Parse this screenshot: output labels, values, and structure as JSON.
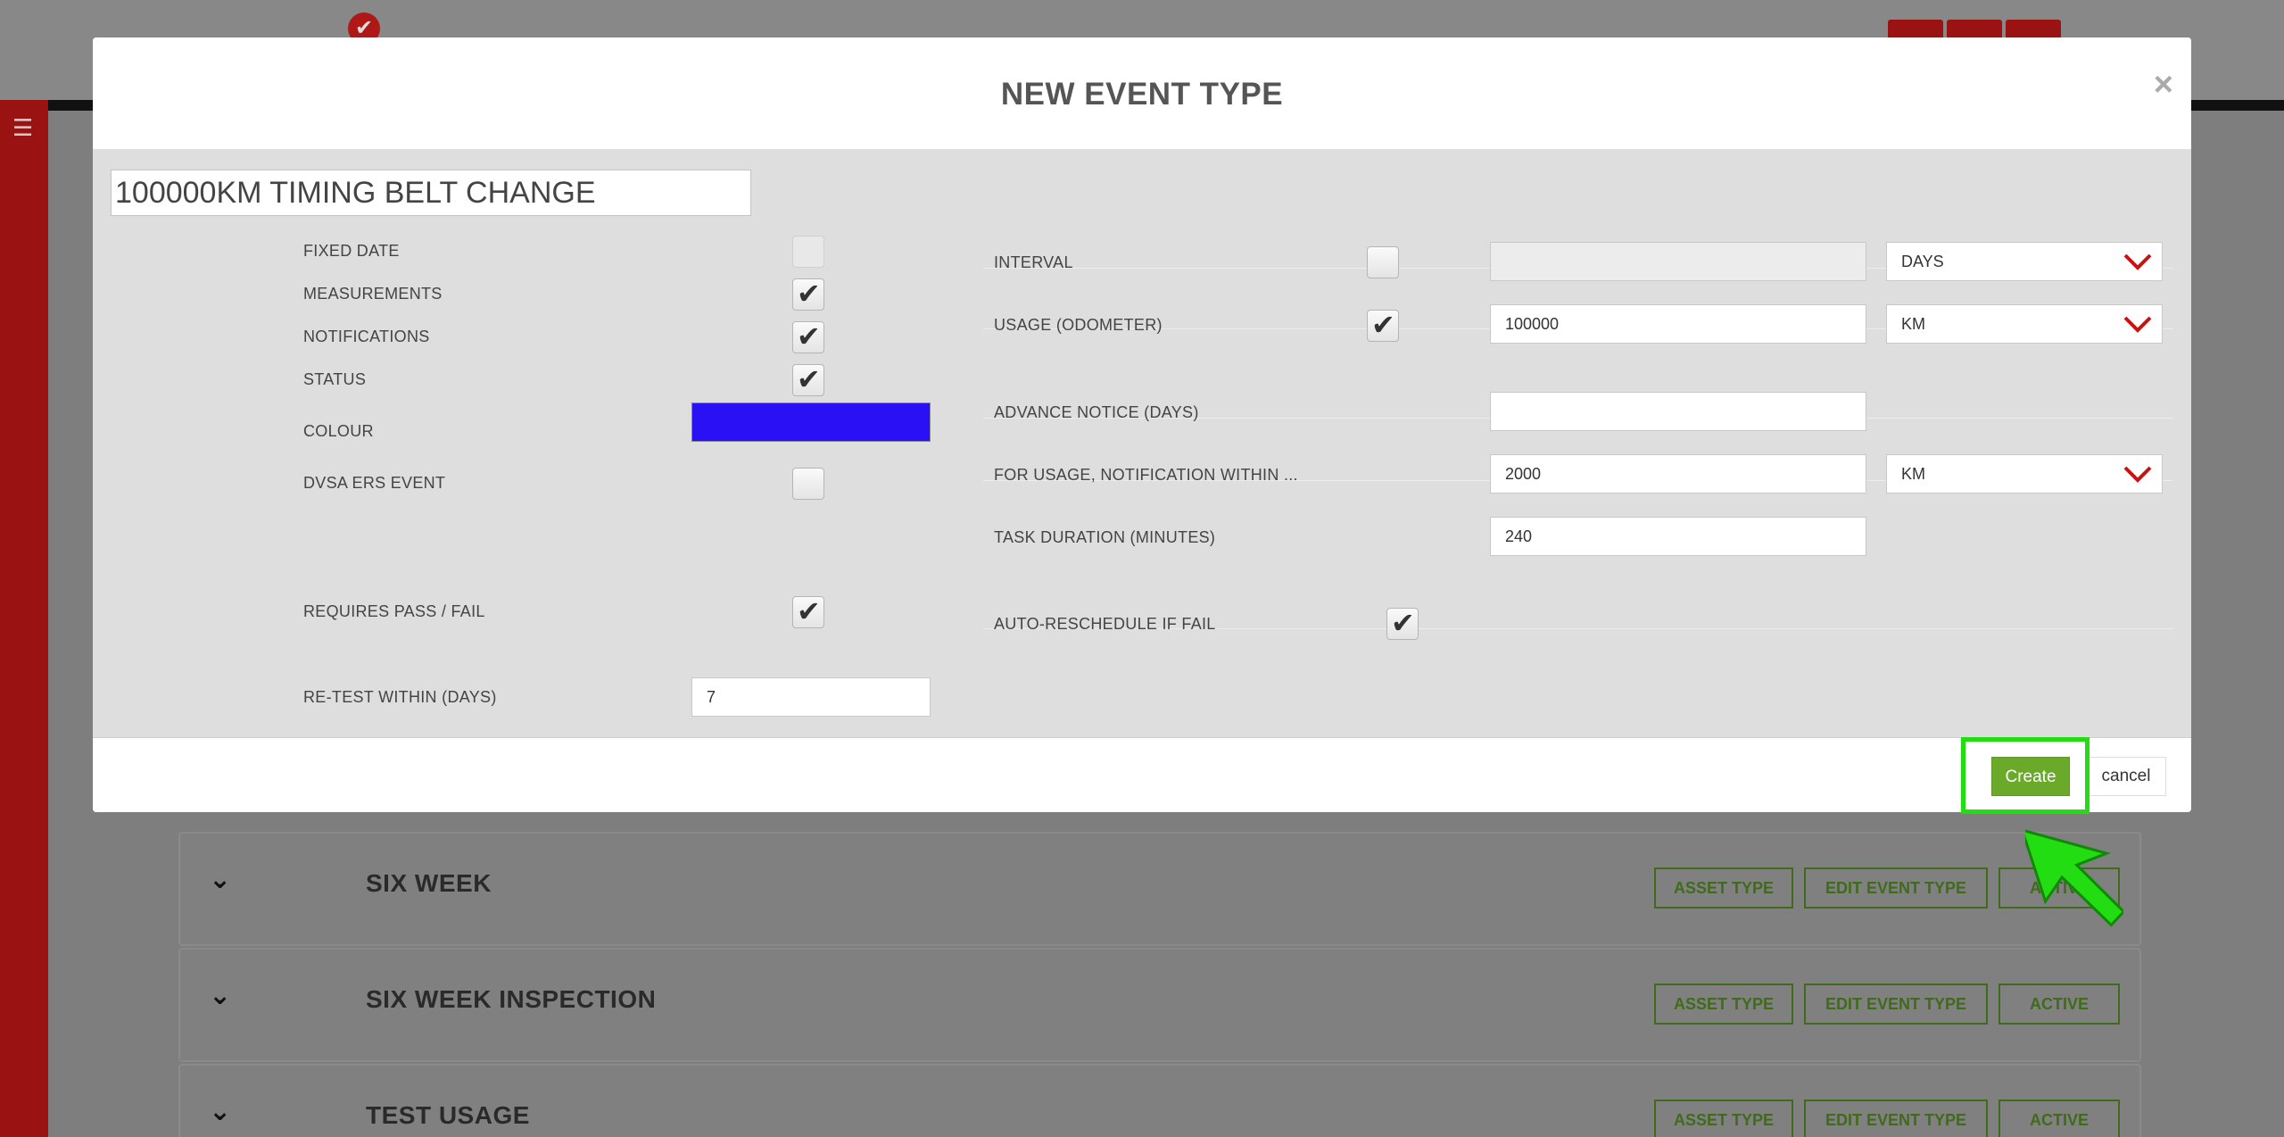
{
  "background": {
    "rows": [
      {
        "title": "SIX WEEK",
        "buttons": [
          "ASSET TYPE",
          "EDIT EVENT TYPE",
          "ACTIVE"
        ]
      },
      {
        "title": "SIX WEEK INSPECTION",
        "buttons": [
          "ASSET TYPE",
          "EDIT EVENT TYPE",
          "ACTIVE"
        ]
      },
      {
        "title": "TEST USAGE",
        "buttons": [
          "ASSET TYPE",
          "EDIT EVENT TYPE",
          "ACTIVE"
        ]
      }
    ]
  },
  "modal": {
    "title": "NEW EVENT TYPE",
    "close_icon": "×",
    "name_value": "100000KM TIMING BELT CHANGE",
    "left": {
      "fixed_date_label": "FIXED DATE",
      "measurements_label": "MEASUREMENTS",
      "notifications_label": "NOTIFICATIONS",
      "status_label": "STATUS",
      "colour_label": "COLOUR",
      "colour_value": "#2a11f5",
      "dvsa_label": "DVSA ERS EVENT",
      "requires_pass_fail_label": "REQUIRES PASS / FAIL",
      "retest_label": "RE-TEST WITHIN (DAYS)",
      "retest_value": "7"
    },
    "right": {
      "interval_label": "INTERVAL",
      "interval_value": "",
      "interval_unit": "DAYS",
      "usage_label": "USAGE (ODOMETER)",
      "usage_value": "100000",
      "usage_unit": "KM",
      "advance_notice_label": "ADVANCE NOTICE (DAYS)",
      "advance_notice_value": "",
      "notify_within_label": "FOR USAGE, NOTIFICATION WITHIN ...",
      "notify_within_value": "2000",
      "notify_within_unit": "KM",
      "task_duration_label": "TASK DURATION (MINUTES)",
      "task_duration_value": "240",
      "auto_reschedule_label": "AUTO-RESCHEDULE IF FAIL"
    },
    "footer": {
      "create_label": "Create",
      "cancel_label": "cancel"
    }
  },
  "colors": {
    "accent_green": "#6aa92a",
    "highlight": "#22dd11",
    "brand_red": "#9a1212",
    "caret_red": "#cc1111"
  },
  "icons": {
    "check": "✔",
    "caret": "chevron-down-icon",
    "menu": "☰"
  }
}
